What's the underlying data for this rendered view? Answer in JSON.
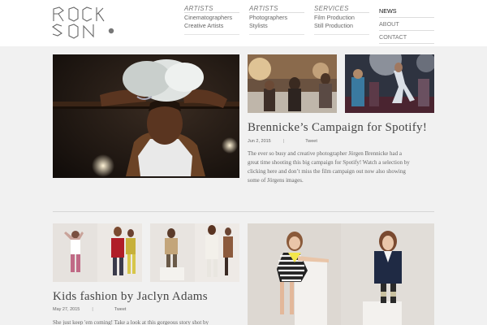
{
  "brand": {
    "logo_text": "ROCK SON"
  },
  "nav": {
    "artists": {
      "title": "ARTISTS",
      "items": [
        "Cinematographers",
        "Creative Artists"
      ]
    },
    "artists2": {
      "title": "ARTISTS",
      "items": [
        "Photographers",
        "Stylists"
      ]
    },
    "services": {
      "title": "SERVICES",
      "items": [
        "Film Production",
        "Still Production"
      ]
    },
    "pages": {
      "items": [
        "NEWS",
        "ABOUT",
        "CONTACT"
      ]
    }
  },
  "posts": [
    {
      "title": "Brennicke’s Campaign for Spotify!",
      "date": "Jun 2, 2015",
      "separator": "|",
      "tweet": "Tweet",
      "excerpt_lines": [
        "The ever so busy and creative photographer Jörgen Brennicke had a",
        "great time shooting this big campaign for Spotify! Watch a selection by",
        "clicking here and don’t miss the film campaign out now also showing",
        "some of Jörgens images."
      ]
    },
    {
      "title": "Kids fashion by Jaclyn Adams",
      "date": "May 27, 2015",
      "separator": "|",
      "tweet": "Tweet",
      "excerpt_lines": [
        "She just keep 'em coming! Take a look at this gorgeous story shot by"
      ]
    }
  ]
}
